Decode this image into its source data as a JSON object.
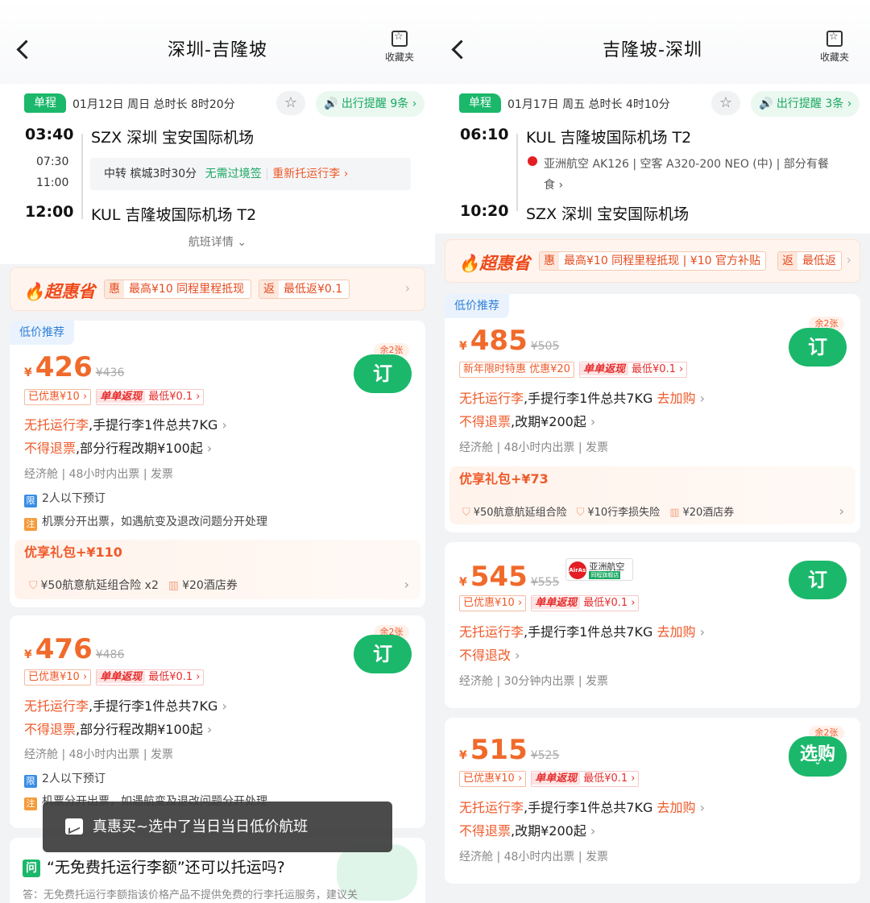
{
  "left": {
    "title": "深圳-吉隆坡",
    "fav_label": "收藏夹",
    "segment": {
      "type": "单程",
      "date_info": "01月12日 周日   总时长 8时20分",
      "remind": "出行提醒 9条",
      "dep_time": "03:40",
      "dep_airport": "SZX 深圳 宝安国际机场",
      "mid_time_1": "07:30",
      "mid_time_2": "11:00",
      "transfer_city": "中转 槟城3时30分",
      "transfer_visa": "无需过境签",
      "transfer_bag": "重新托运行李",
      "arr_time": "12:00",
      "arr_airport": "KUL 吉隆坡国际机场 T2",
      "detail": "航班详情"
    },
    "banner": {
      "logo": "超惠省",
      "chip1_tag": "惠",
      "chip1_text": "最高¥10 同程里程抵现",
      "chip2_tag": "返",
      "chip2_text": "最低返¥0.1"
    },
    "cards": [
      {
        "low_tag": "低价推荐",
        "currency": "¥",
        "price": "426",
        "orig": "¥436",
        "left": "余2张",
        "book": "订",
        "promo1": "已优惠¥10",
        "promo2": "单单返现",
        "promo2_sub": "最低¥0.1",
        "bag_red": "无托运行李",
        "bag_rest": ",手提行李1件总共7KG",
        "refund_red": "不得退票",
        "refund_rest": ",部分行程改期¥100起",
        "cabin": "经济舱 | 48小时内出票 | 发票",
        "limit_icon": "限",
        "limit": "2人以下预订",
        "note_icon": "注",
        "note": "机票分开出票，如遇航变及退改问题分开处理",
        "gift_title": "优享礼包+¥110",
        "gift1": "¥50航意航延组合险 x2",
        "gift2": "¥20酒店券"
      },
      {
        "currency": "¥",
        "price": "476",
        "orig": "¥486",
        "left": "余2张",
        "book": "订",
        "promo1": "已优惠¥10",
        "promo2": "单单返现",
        "promo2_sub": "最低¥0.1",
        "bag_red": "无托运行李",
        "bag_rest": ",手提行李1件总共7KG",
        "refund_red": "不得退票",
        "refund_rest": ",部分行程改期¥100起",
        "cabin": "经济舱 | 48小时内出票 | 发票",
        "limit_icon": "限",
        "limit": "2人以下预订",
        "note_icon": "注",
        "note": "机票分开出票，如遇航变及退改问题分开处理"
      }
    ],
    "toast": "真惠买~选中了当日当日低价航班",
    "faq": {
      "icon": "问",
      "question": "“无免费托运行李额”还可以托运吗?",
      "answer": "答：无免费托运行李额指该价格产品不提供免费的行李托运服务，建议关"
    }
  },
  "right": {
    "title": "吉隆坡-深圳",
    "fav_label": "收藏夹",
    "segment": {
      "type": "单程",
      "date_info": "01月17日 周五   总时长 4时10分",
      "remind": "出行提醒 3条",
      "dep_time": "06:10",
      "dep_airport": "KUL 吉隆坡国际机场 T2",
      "flight_line1": "亚洲航空 AK126 | 空客 A320-200 NEO (中) | 部分有餐",
      "flight_line2": "食",
      "arr_time": "10:20",
      "arr_airport": "SZX 深圳 宝安国际机场"
    },
    "banner": {
      "logo": "超惠省",
      "chip1_tag": "惠",
      "chip1_text": "最高¥10 同程里程抵现 | ¥10 官方补贴",
      "chip2_tag": "返",
      "chip2_text": "最低返"
    },
    "cards": [
      {
        "low_tag": "低价推荐",
        "currency": "¥",
        "price": "485",
        "orig": "¥505",
        "left": "余2张",
        "book": "订",
        "promo1": "新年限时特惠 优惠¥20",
        "promo2": "单单返现",
        "promo2_sub": "最低¥0.1",
        "bag_red": "无托运行李",
        "bag_rest": ",手提行李1件总共7KG",
        "buy": "去加购",
        "refund_red": "不得退票",
        "refund_rest": ",改期¥200起",
        "cabin": "经济舱 | 48小时内出票 | 发票",
        "gift_title": "优享礼包+¥73",
        "gift1": "¥50航意航延组合险",
        "gift2": "¥10行李损失险",
        "gift3": "¥20酒店券"
      },
      {
        "currency": "¥",
        "price": "545",
        "orig": "¥555",
        "airline_name": "亚洲航空",
        "airline_sub": "同程旗舰店",
        "airline_mark": "AirAsia",
        "book": "订",
        "promo1": "已优惠¥10",
        "promo2": "单单返现",
        "promo2_sub": "最低¥0.1",
        "bag_red": "无托运行李",
        "bag_rest": ",手提行李1件总共7KG",
        "buy": "去加购",
        "refund_red": "不得退改",
        "cabin": "经济舱 | 30分钟内出票 | 发票"
      },
      {
        "currency": "¥",
        "price": "515",
        "orig": "¥525",
        "left": "余2张",
        "book": "选购",
        "promo1": "已优惠¥10",
        "promo2": "单单返现",
        "promo2_sub": "最低¥0.1",
        "bag_red": "无托运行李",
        "bag_rest": ",手提行李1件总共7KG",
        "buy": "去加购",
        "refund_red": "不得退票",
        "refund_rest": ",改期¥200起",
        "cabin": "经济舱 | 48小时内出票 | 发票"
      }
    ]
  },
  "colors": {
    "accent_green": "#1bb86b",
    "price_orange": "#f06a2b",
    "warn_red": "#ef5a2a"
  }
}
